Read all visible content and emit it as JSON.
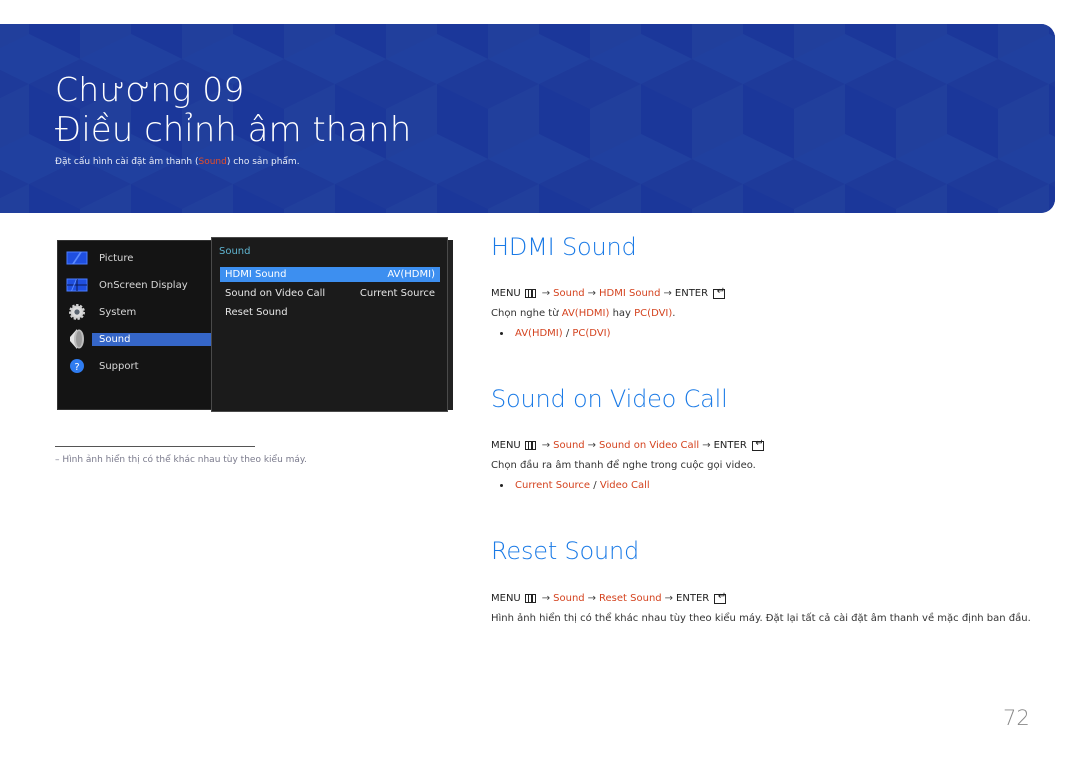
{
  "banner": {
    "chapter": "Chương 09",
    "title": "Điều chỉnh âm thanh",
    "subtitle_pre": "Đặt cấu hình cài đặt âm thanh (",
    "subtitle_highlight": "Sound",
    "subtitle_post": ") cho sản phẩm."
  },
  "osd": {
    "menu": [
      {
        "label": "Picture",
        "icon": "picture-icon"
      },
      {
        "label": "OnScreen Display",
        "icon": "onscreen-display-icon"
      },
      {
        "label": "System",
        "icon": "gear-icon"
      },
      {
        "label": "Sound",
        "icon": "speaker-icon",
        "active": true
      },
      {
        "label": "Support",
        "icon": "help-icon"
      }
    ],
    "submenu_title": "Sound",
    "submenu": [
      {
        "label": "HDMI Sound",
        "value": "AV(HDMI)",
        "selected": true
      },
      {
        "label": "Sound on Video Call",
        "value": "Current Source"
      },
      {
        "label": "Reset Sound",
        "value": ""
      }
    ]
  },
  "footnote": "–  Hình ảnh hiển thị có thể khác nhau tùy theo kiểu máy.",
  "sections": [
    {
      "title": "HDMI Sound",
      "path": {
        "menu": "MENU",
        "steps": [
          "Sound",
          "HDMI Sound"
        ],
        "enter": "ENTER"
      },
      "desc_pre": "Chọn nghe từ ",
      "desc_opt1": "AV(HDMI)",
      "desc_mid": " hay ",
      "desc_opt2": "PC(DVI)",
      "desc_post": ".",
      "options": [
        "AV(HDMI)",
        "PC(DVI)"
      ]
    },
    {
      "title": "Sound on Video Call",
      "path": {
        "menu": "MENU",
        "steps": [
          "Sound",
          "Sound on Video Call"
        ],
        "enter": "ENTER"
      },
      "desc": "Chọn đầu ra âm thanh để nghe trong cuộc gọi video.",
      "options": [
        "Current Source",
        "Video Call"
      ]
    },
    {
      "title": "Reset Sound",
      "path": {
        "menu": "MENU",
        "steps": [
          "Sound",
          "Reset Sound"
        ],
        "enter": "ENTER"
      },
      "desc": "Hình ảnh hiển thị có thể khác nhau tùy theo kiểu máy. Đặt lại tất cả cài đặt âm thanh về mặc định ban đầu."
    }
  ],
  "separator": " / ",
  "arrow": "→",
  "page_number": "72",
  "colors": {
    "banner": "#1e3a9a",
    "heading": "#1a7ae6",
    "highlight": "#d4431f",
    "osd_selected": "#3d8ff0"
  }
}
